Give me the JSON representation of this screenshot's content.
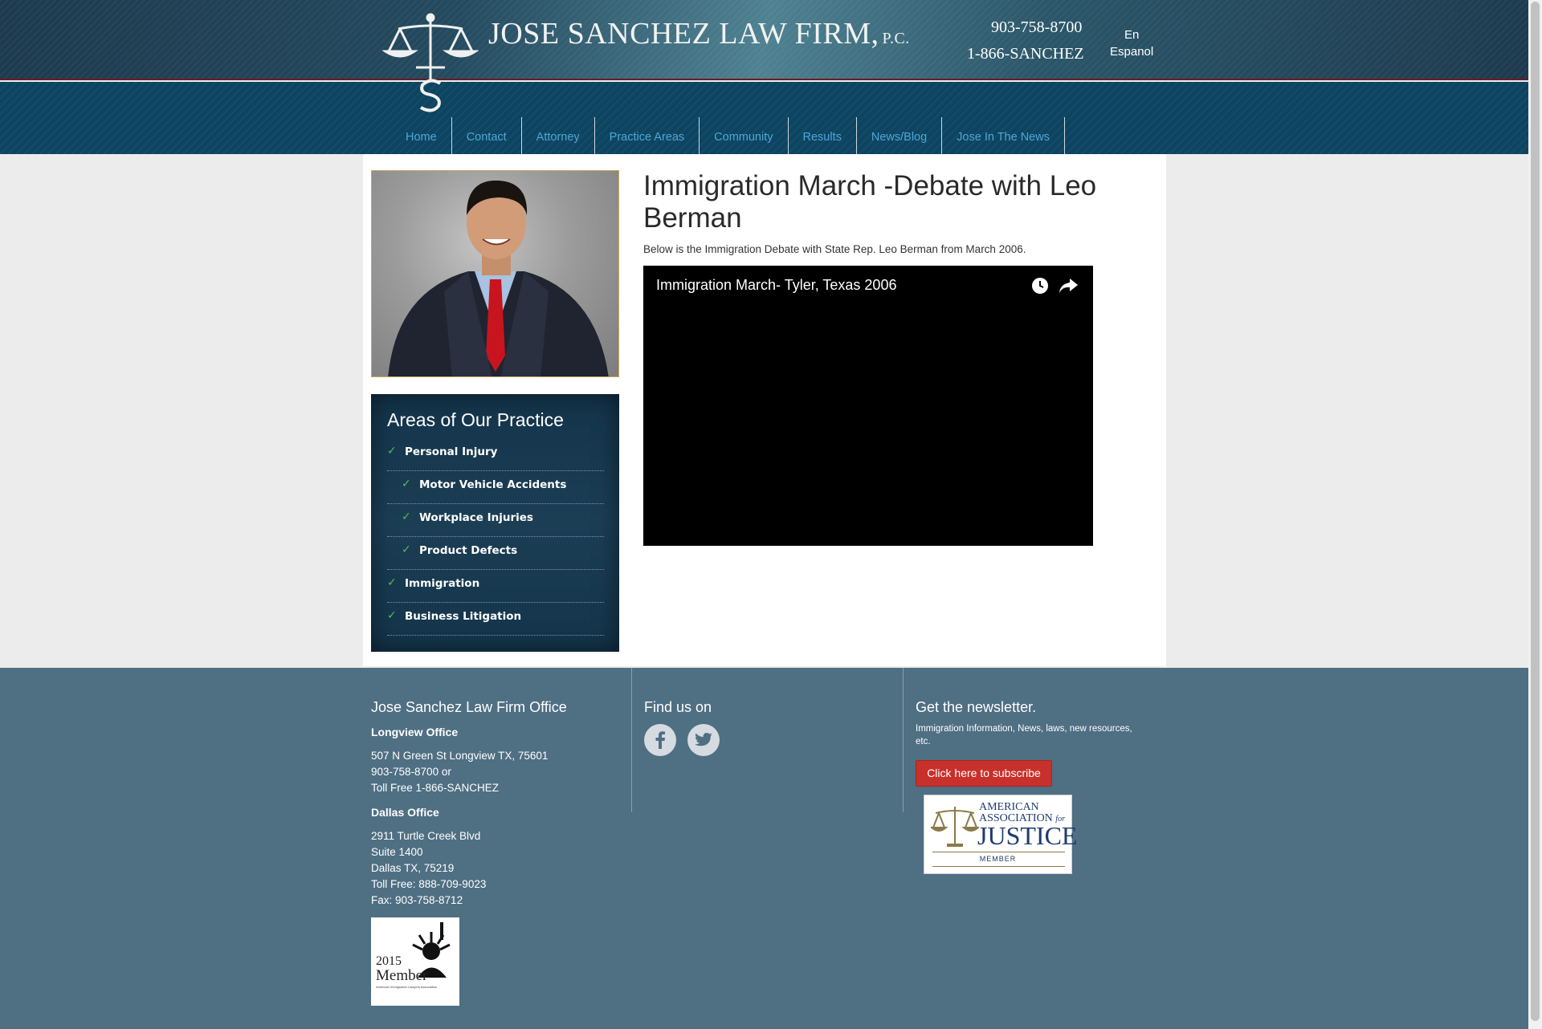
{
  "header": {
    "firm_name": "JOSE SANCHEZ LAW FIRM,",
    "firm_suffix": "P.C.",
    "phone": "903-758-8700",
    "toll_free": "1-866-SANCHEZ",
    "lang_en": "En",
    "lang_es": "Espanol"
  },
  "nav": {
    "items": [
      {
        "label": "Home"
      },
      {
        "label": "Contact"
      },
      {
        "label": "Attorney"
      },
      {
        "label": "Practice Areas"
      },
      {
        "label": "Community"
      },
      {
        "label": "Results"
      },
      {
        "label": "News/Blog"
      },
      {
        "label": "Jose In The News"
      }
    ]
  },
  "sidebar": {
    "practice_title": "Areas of Our Practice",
    "practice_items": [
      {
        "label": "Personal Injury",
        "level": "top"
      },
      {
        "label": "Motor Vehicle Accidents",
        "level": "sub"
      },
      {
        "label": "Workplace Injuries",
        "level": "sub"
      },
      {
        "label": "Product Defects",
        "level": "sub"
      },
      {
        "label": "Immigration",
        "level": "top"
      },
      {
        "label": "Business Litigation",
        "level": "top"
      }
    ]
  },
  "article": {
    "title": "Immigration March -Debate with Leo Berman",
    "intro": "Below is the Immigration Debate with State Rep. Leo Berman from March 2006.",
    "video_title": "Immigration March- Tyler, Texas 2006"
  },
  "footer": {
    "office_title": "Jose Sanchez Law Firm Office",
    "longview_title": "Longview Office",
    "longview_lines": [
      "507 N Green St Longview TX, 75601",
      "903-758-8700 or",
      "Toll Free 1-866-SANCHEZ"
    ],
    "dallas_title": "Dallas Office",
    "dallas_lines": [
      "2911 Turtle Creek Blvd",
      "Suite 1400",
      "Dallas TX, 75219",
      "Toll Free: 888-709-9023",
      "Fax: 903-758-8712"
    ],
    "find_title": "Find us on",
    "newsletter_title": "Get the newsletter.",
    "newsletter_desc_1": "Immigration Information, News, laws, new resources,",
    "newsletter_desc_2": "etc.",
    "subscribe_label": "Click here to subscribe",
    "aaj_line1": "AMERICAN",
    "aaj_line2": "ASSOCIATION",
    "aaj_for": "for",
    "aaj_line3": "JUSTICE",
    "aaj_member": "MEMBER",
    "aila_year": "2015",
    "aila_member": "Member",
    "aila_org": "American Immigration Lawyers Association"
  },
  "colors": {
    "nav_link": "#4ea7d8",
    "header_bar": "#0c4461",
    "footer_bg": "#4f6f83",
    "subscribe_bg": "#c8302b",
    "check": "#4fbf56"
  },
  "icons": [
    "scales-logo-icon",
    "clock-icon",
    "share-icon",
    "facebook-icon",
    "twitter-icon",
    "check-icon"
  ]
}
